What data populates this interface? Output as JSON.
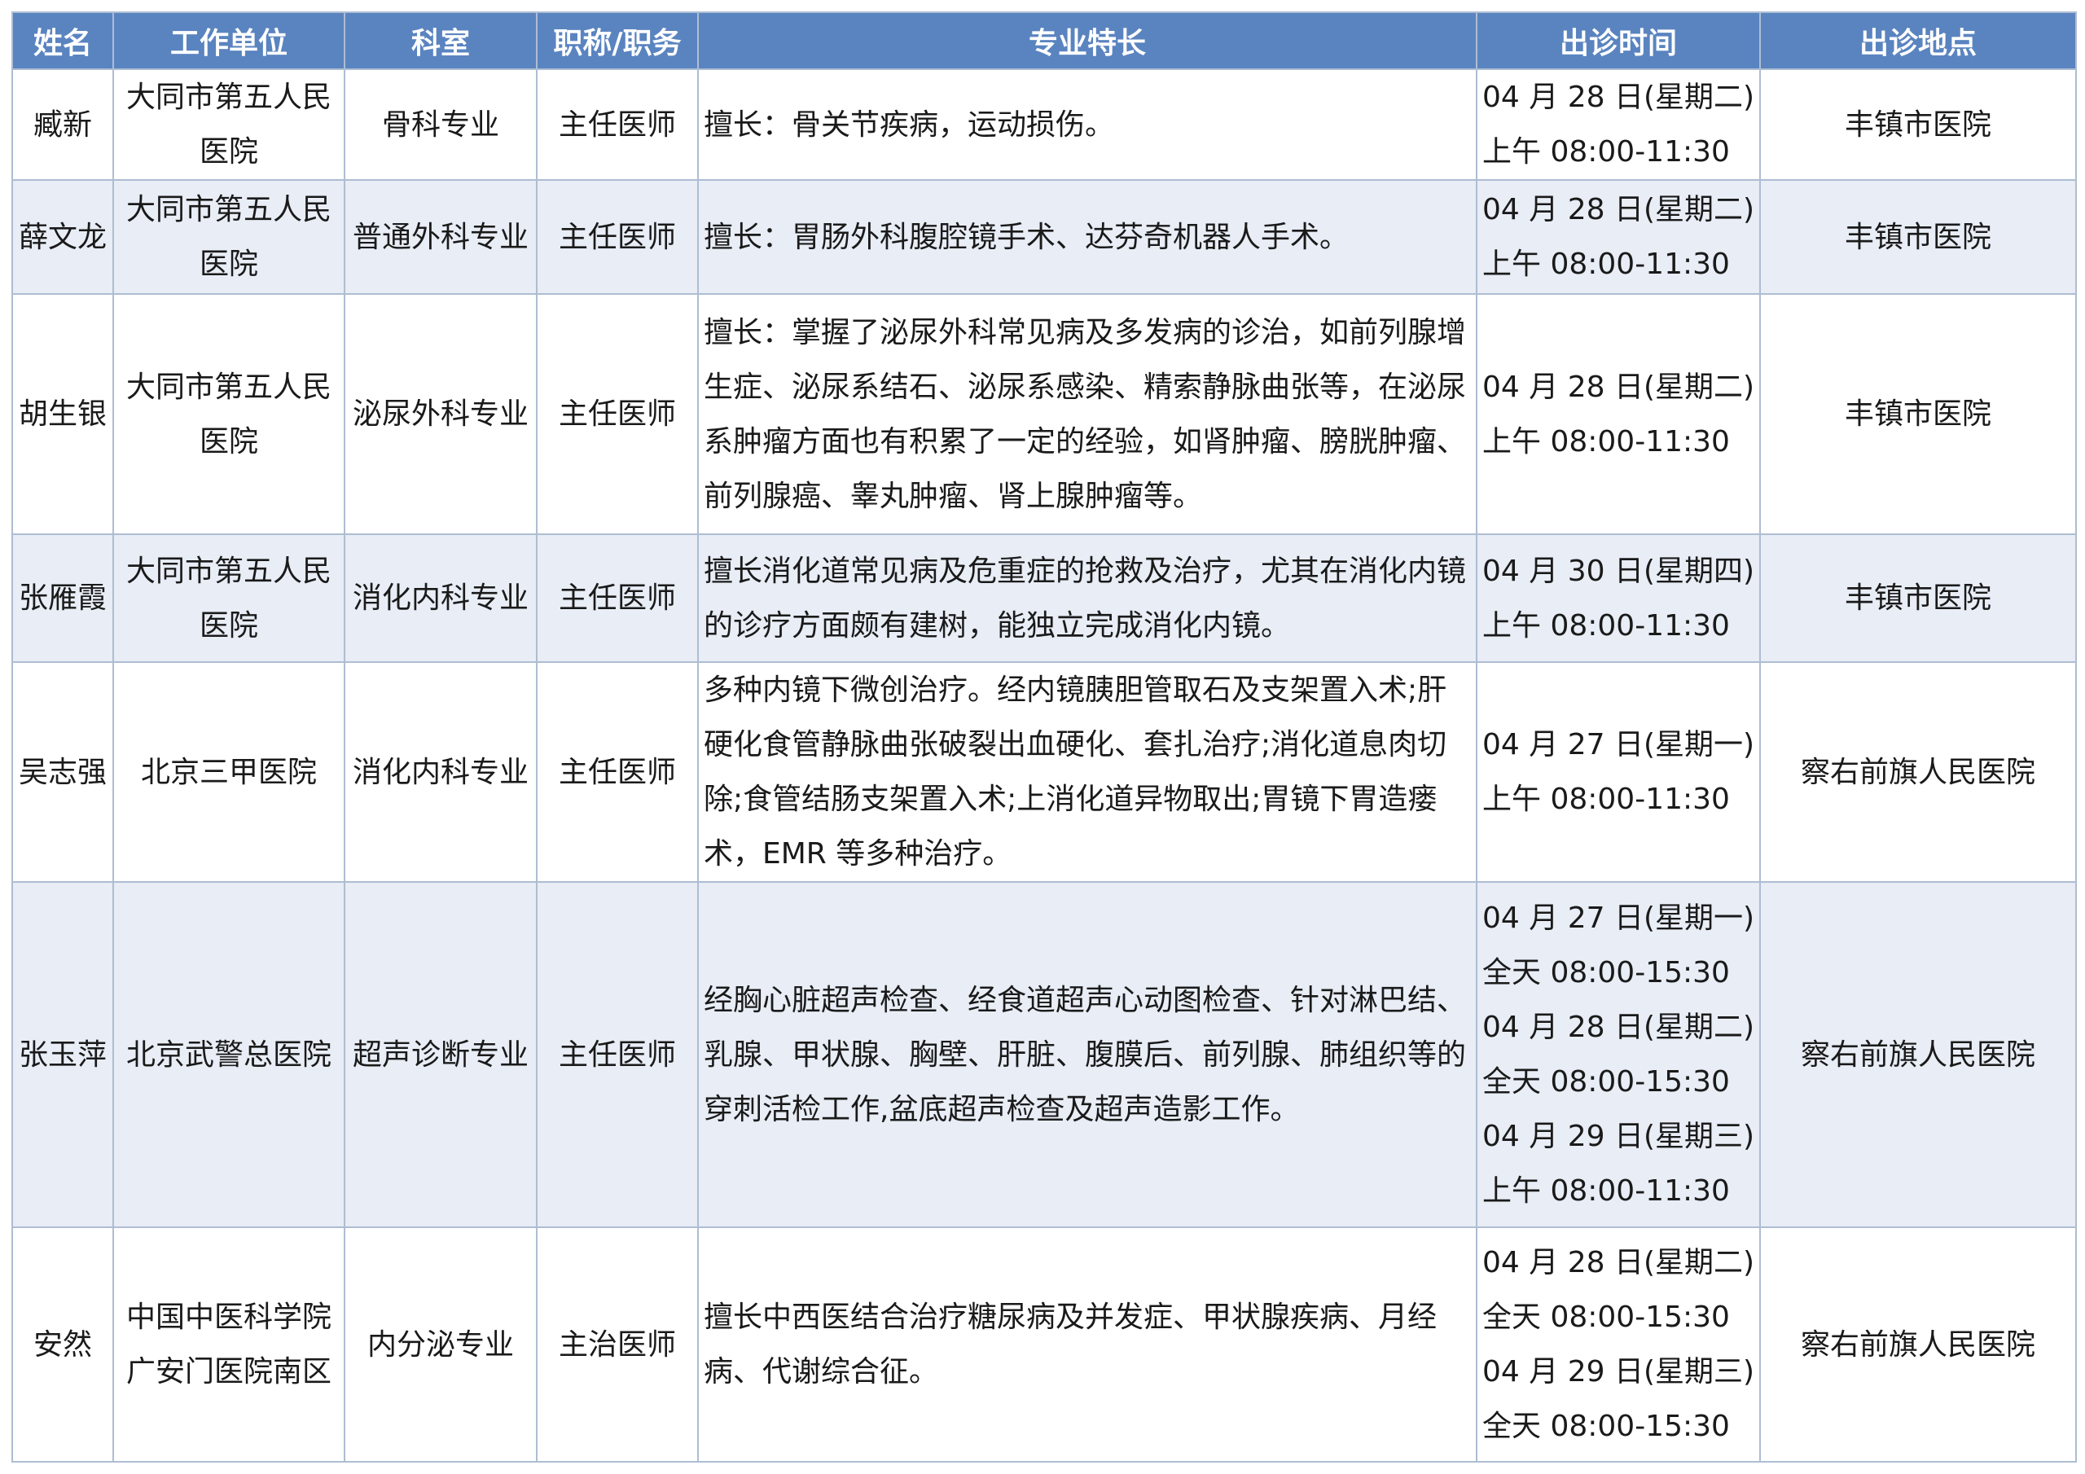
{
  "header": {
    "name": "姓名",
    "unit": "工作单位",
    "department": "科室",
    "title": "职称/职务",
    "specialty": "专业特长",
    "time": "出诊时间",
    "location": "出诊地点"
  },
  "colors": {
    "header_bg": "#5a84c0",
    "header_text": "#ffffff",
    "alt_row_bg": "#e8edf6",
    "border": "#aebdd3"
  },
  "rows": [
    {
      "name": "臧新",
      "unit_lines": [
        "大同市第五人民",
        "医院"
      ],
      "department": "骨科专业",
      "title": "主任医师",
      "specialty": "擅长：骨关节疾病，运动损伤。",
      "times": [
        "04 月 28 日(星期二)",
        "上午 08:00-11:30"
      ],
      "location": "丰镇市医院"
    },
    {
      "name": "薛文龙",
      "unit_lines": [
        "大同市第五人民",
        "医院"
      ],
      "department": "普通外科专业",
      "title": "主任医师",
      "specialty": "擅长：胃肠外科腹腔镜手术、达芬奇机器人手术。",
      "times": [
        "04 月 28 日(星期二)",
        "上午 08:00-11:30"
      ],
      "location": "丰镇市医院"
    },
    {
      "name": "胡生银",
      "unit_lines": [
        "大同市第五人民",
        "医院"
      ],
      "department": "泌尿外科专业",
      "title": "主任医师",
      "specialty": "擅长：掌握了泌尿外科常见病及多发病的诊治，如前列腺增生症、泌尿系结石、泌尿系感染、精索静脉曲张等，在泌尿系肿瘤方面也有积累了一定的经验，如肾肿瘤、膀胱肿瘤、前列腺癌、睾丸肿瘤、肾上腺肿瘤等。",
      "times": [
        "04 月 28 日(星期二)",
        "上午 08:00-11:30"
      ],
      "location": "丰镇市医院"
    },
    {
      "name": "张雁霞",
      "unit_lines": [
        "大同市第五人民",
        "医院"
      ],
      "department": "消化内科专业",
      "title": "主任医师",
      "specialty": "擅长消化道常见病及危重症的抢救及治疗，尤其在消化内镜的诊疗方面颇有建树，能独立完成消化内镜。",
      "times": [
        "04 月 30 日(星期四)",
        "上午 08:00-11:30"
      ],
      "location": "丰镇市医院"
    },
    {
      "name": "吴志强",
      "unit_lines": [
        "北京三甲医院"
      ],
      "department": "消化内科专业",
      "title": "主任医师",
      "specialty": "多种内镜下微创治疗。经内镜胰胆管取石及支架置入术;肝硬化食管静脉曲张破裂出血硬化、套扎治疗;消化道息肉切除;食管结肠支架置入术;上消化道异物取出;胃镜下胃造瘘术，EMR 等多种治疗。",
      "times": [
        "04 月 27 日(星期一)",
        "上午 08:00-11:30"
      ],
      "location": "察右前旗人民医院"
    },
    {
      "name": "张玉萍",
      "unit_lines": [
        "北京武警总医院"
      ],
      "department": "超声诊断专业",
      "title": "主任医师",
      "specialty": "经胸心脏超声检查、经食道超声心动图检查、针对淋巴结、乳腺、甲状腺、胸壁、肝脏、腹膜后、前列腺、肺组织等的穿刺活检工作,盆底超声检查及超声造影工作。",
      "times": [
        "04 月 27 日(星期一)",
        "全天 08:00-15:30",
        "04 月 28 日(星期二)",
        "全天 08:00-15:30",
        "04 月 29 日(星期三)",
        "上午 08:00-11:30"
      ],
      "location": "察右前旗人民医院"
    },
    {
      "name": "安然",
      "unit_lines": [
        "中国中医科学院",
        "广安门医院南区"
      ],
      "department": "内分泌专业",
      "title": "主治医师",
      "specialty": "擅长中西医结合治疗糖尿病及并发症、甲状腺疾病、月经病、代谢综合征。",
      "times": [
        "04 月 28 日(星期二)",
        "全天 08:00-15:30",
        "04 月 29 日(星期三)",
        "全天 08:00-15:30"
      ],
      "location": "察右前旗人民医院"
    }
  ]
}
